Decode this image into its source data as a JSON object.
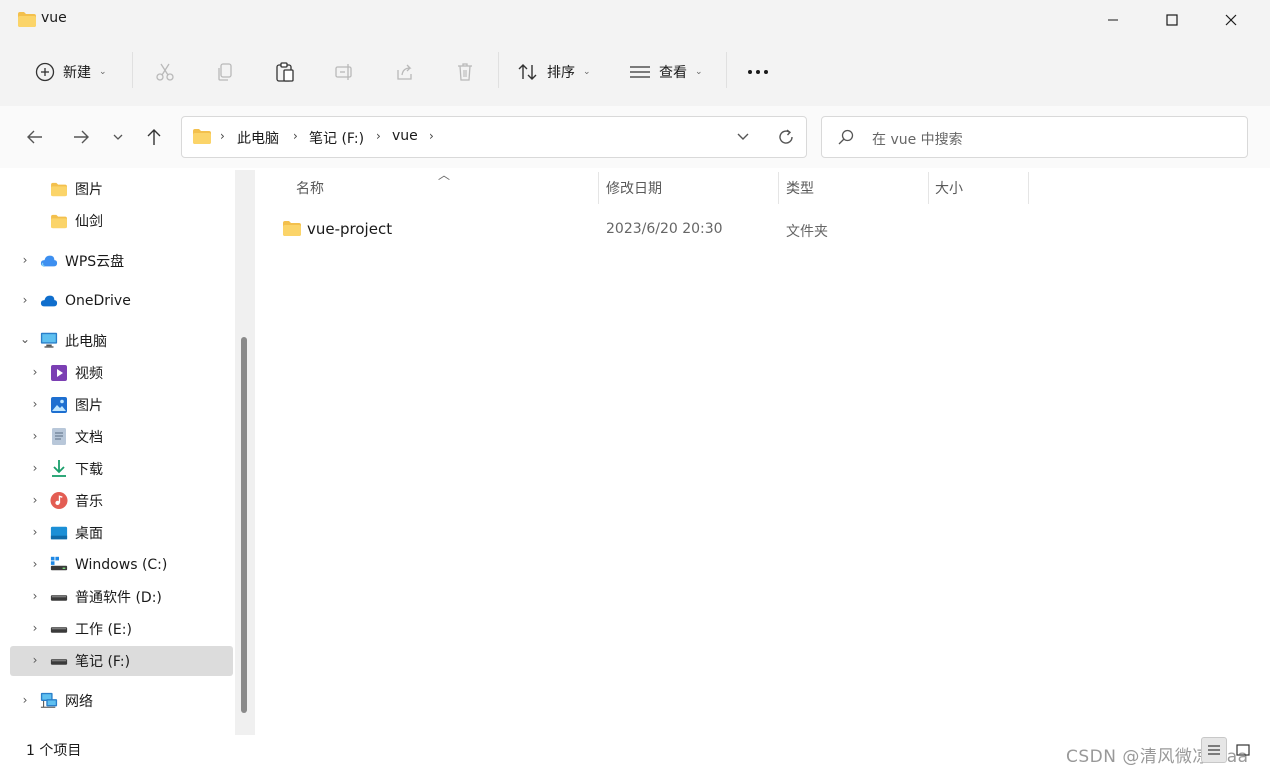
{
  "window": {
    "title": "vue"
  },
  "toolbar": {
    "new_label": "新建",
    "sort_label": "排序",
    "view_label": "查看"
  },
  "address": {
    "crumbs": [
      "此电脑",
      "笔记 (F:)",
      "vue"
    ]
  },
  "search": {
    "placeholder": "在 vue 中搜索"
  },
  "nav": {
    "pics_quick": "图片",
    "xianjian": "仙剑",
    "wps": "WPS云盘",
    "onedrive": "OneDrive",
    "this_pc": "此电脑",
    "videos": "视频",
    "pictures": "图片",
    "documents": "文档",
    "downloads": "下载",
    "music": "音乐",
    "desktop": "桌面",
    "drive_c": "Windows (C:)",
    "drive_d": "普通软件 (D:)",
    "drive_e": "工作 (E:)",
    "drive_f": "笔记 (F:)",
    "network": "网络"
  },
  "columns": {
    "name": "名称",
    "modified": "修改日期",
    "type": "类型",
    "size": "大小"
  },
  "files": [
    {
      "name": "vue-project",
      "modified": "2023/6/20 20:30",
      "type": "文件夹",
      "size": ""
    }
  ],
  "status": {
    "count": "1 个项目"
  },
  "watermark": "CSDN @清风微凉 aaa",
  "colors": {
    "folder": "#f3c04d",
    "selected": "#dcdcdc",
    "accent": "#0067c0"
  }
}
